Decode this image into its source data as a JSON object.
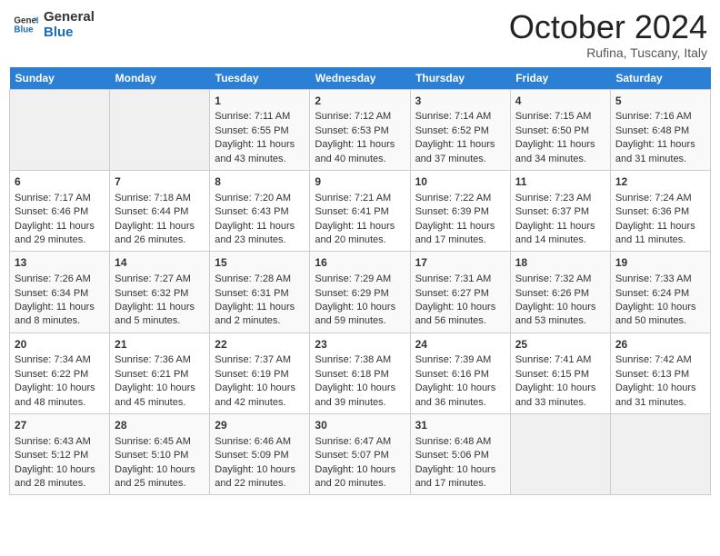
{
  "header": {
    "logo_line1": "General",
    "logo_line2": "Blue",
    "month_title": "October 2024",
    "location": "Rufina, Tuscany, Italy"
  },
  "days_of_week": [
    "Sunday",
    "Monday",
    "Tuesday",
    "Wednesday",
    "Thursday",
    "Friday",
    "Saturday"
  ],
  "weeks": [
    [
      {
        "day": "",
        "info": ""
      },
      {
        "day": "",
        "info": ""
      },
      {
        "day": "1",
        "info": "Sunrise: 7:11 AM\nSunset: 6:55 PM\nDaylight: 11 hours and 43 minutes."
      },
      {
        "day": "2",
        "info": "Sunrise: 7:12 AM\nSunset: 6:53 PM\nDaylight: 11 hours and 40 minutes."
      },
      {
        "day": "3",
        "info": "Sunrise: 7:14 AM\nSunset: 6:52 PM\nDaylight: 11 hours and 37 minutes."
      },
      {
        "day": "4",
        "info": "Sunrise: 7:15 AM\nSunset: 6:50 PM\nDaylight: 11 hours and 34 minutes."
      },
      {
        "day": "5",
        "info": "Sunrise: 7:16 AM\nSunset: 6:48 PM\nDaylight: 11 hours and 31 minutes."
      }
    ],
    [
      {
        "day": "6",
        "info": "Sunrise: 7:17 AM\nSunset: 6:46 PM\nDaylight: 11 hours and 29 minutes."
      },
      {
        "day": "7",
        "info": "Sunrise: 7:18 AM\nSunset: 6:44 PM\nDaylight: 11 hours and 26 minutes."
      },
      {
        "day": "8",
        "info": "Sunrise: 7:20 AM\nSunset: 6:43 PM\nDaylight: 11 hours and 23 minutes."
      },
      {
        "day": "9",
        "info": "Sunrise: 7:21 AM\nSunset: 6:41 PM\nDaylight: 11 hours and 20 minutes."
      },
      {
        "day": "10",
        "info": "Sunrise: 7:22 AM\nSunset: 6:39 PM\nDaylight: 11 hours and 17 minutes."
      },
      {
        "day": "11",
        "info": "Sunrise: 7:23 AM\nSunset: 6:37 PM\nDaylight: 11 hours and 14 minutes."
      },
      {
        "day": "12",
        "info": "Sunrise: 7:24 AM\nSunset: 6:36 PM\nDaylight: 11 hours and 11 minutes."
      }
    ],
    [
      {
        "day": "13",
        "info": "Sunrise: 7:26 AM\nSunset: 6:34 PM\nDaylight: 11 hours and 8 minutes."
      },
      {
        "day": "14",
        "info": "Sunrise: 7:27 AM\nSunset: 6:32 PM\nDaylight: 11 hours and 5 minutes."
      },
      {
        "day": "15",
        "info": "Sunrise: 7:28 AM\nSunset: 6:31 PM\nDaylight: 11 hours and 2 minutes."
      },
      {
        "day": "16",
        "info": "Sunrise: 7:29 AM\nSunset: 6:29 PM\nDaylight: 10 hours and 59 minutes."
      },
      {
        "day": "17",
        "info": "Sunrise: 7:31 AM\nSunset: 6:27 PM\nDaylight: 10 hours and 56 minutes."
      },
      {
        "day": "18",
        "info": "Sunrise: 7:32 AM\nSunset: 6:26 PM\nDaylight: 10 hours and 53 minutes."
      },
      {
        "day": "19",
        "info": "Sunrise: 7:33 AM\nSunset: 6:24 PM\nDaylight: 10 hours and 50 minutes."
      }
    ],
    [
      {
        "day": "20",
        "info": "Sunrise: 7:34 AM\nSunset: 6:22 PM\nDaylight: 10 hours and 48 minutes."
      },
      {
        "day": "21",
        "info": "Sunrise: 7:36 AM\nSunset: 6:21 PM\nDaylight: 10 hours and 45 minutes."
      },
      {
        "day": "22",
        "info": "Sunrise: 7:37 AM\nSunset: 6:19 PM\nDaylight: 10 hours and 42 minutes."
      },
      {
        "day": "23",
        "info": "Sunrise: 7:38 AM\nSunset: 6:18 PM\nDaylight: 10 hours and 39 minutes."
      },
      {
        "day": "24",
        "info": "Sunrise: 7:39 AM\nSunset: 6:16 PM\nDaylight: 10 hours and 36 minutes."
      },
      {
        "day": "25",
        "info": "Sunrise: 7:41 AM\nSunset: 6:15 PM\nDaylight: 10 hours and 33 minutes."
      },
      {
        "day": "26",
        "info": "Sunrise: 7:42 AM\nSunset: 6:13 PM\nDaylight: 10 hours and 31 minutes."
      }
    ],
    [
      {
        "day": "27",
        "info": "Sunrise: 6:43 AM\nSunset: 5:12 PM\nDaylight: 10 hours and 28 minutes."
      },
      {
        "day": "28",
        "info": "Sunrise: 6:45 AM\nSunset: 5:10 PM\nDaylight: 10 hours and 25 minutes."
      },
      {
        "day": "29",
        "info": "Sunrise: 6:46 AM\nSunset: 5:09 PM\nDaylight: 10 hours and 22 minutes."
      },
      {
        "day": "30",
        "info": "Sunrise: 6:47 AM\nSunset: 5:07 PM\nDaylight: 10 hours and 20 minutes."
      },
      {
        "day": "31",
        "info": "Sunrise: 6:48 AM\nSunset: 5:06 PM\nDaylight: 10 hours and 17 minutes."
      },
      {
        "day": "",
        "info": ""
      },
      {
        "day": "",
        "info": ""
      }
    ]
  ]
}
